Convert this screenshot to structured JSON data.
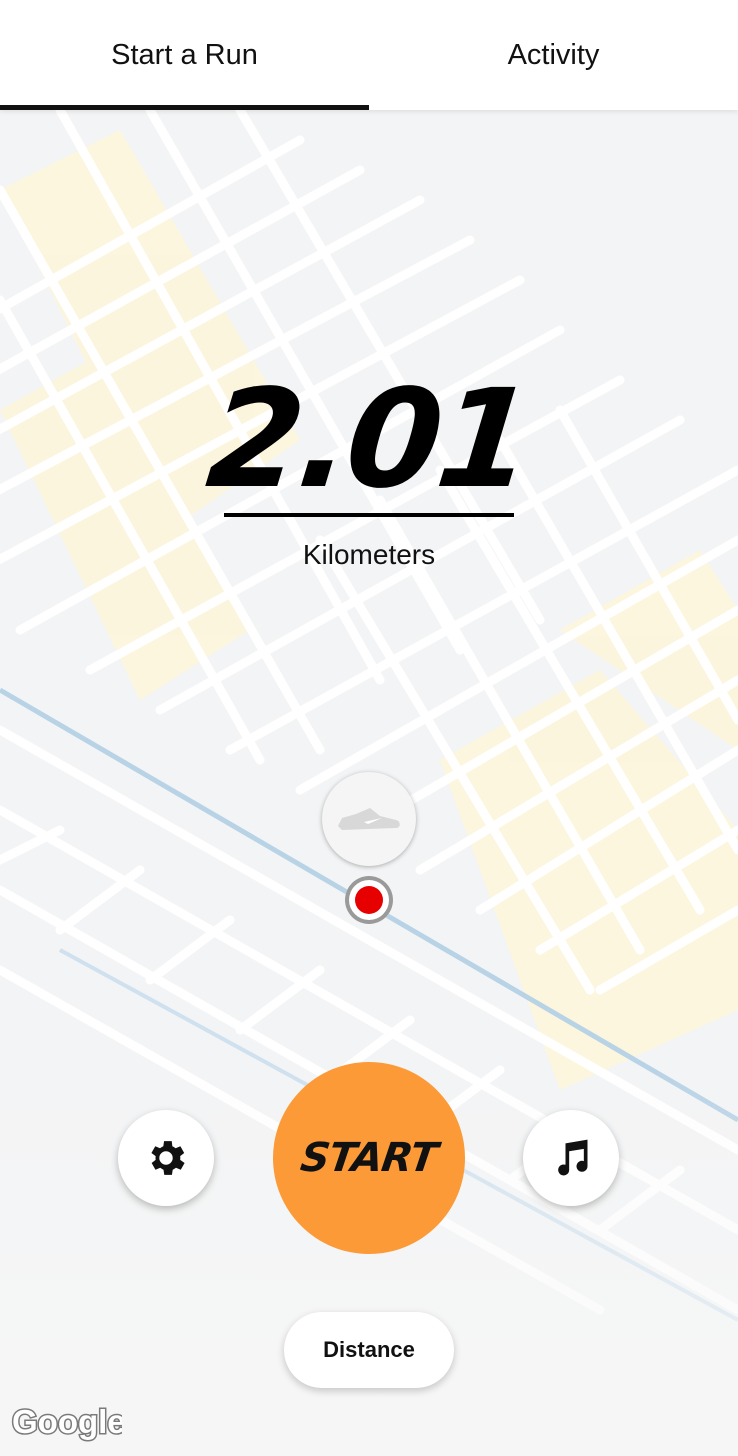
{
  "tabs": {
    "start_run": "Start a Run",
    "activity": "Activity"
  },
  "run": {
    "distance_value": "2.01",
    "distance_unit": "Kilometers"
  },
  "controls": {
    "start_label": "START",
    "goal_type_label": "Distance",
    "settings_icon": "gear-icon",
    "music_icon": "music-note-icon"
  },
  "map": {
    "attribution": "Google"
  },
  "colors": {
    "start_button": "#fb9a37",
    "location_dot": "#e60000",
    "tab_indicator": "#111111"
  }
}
